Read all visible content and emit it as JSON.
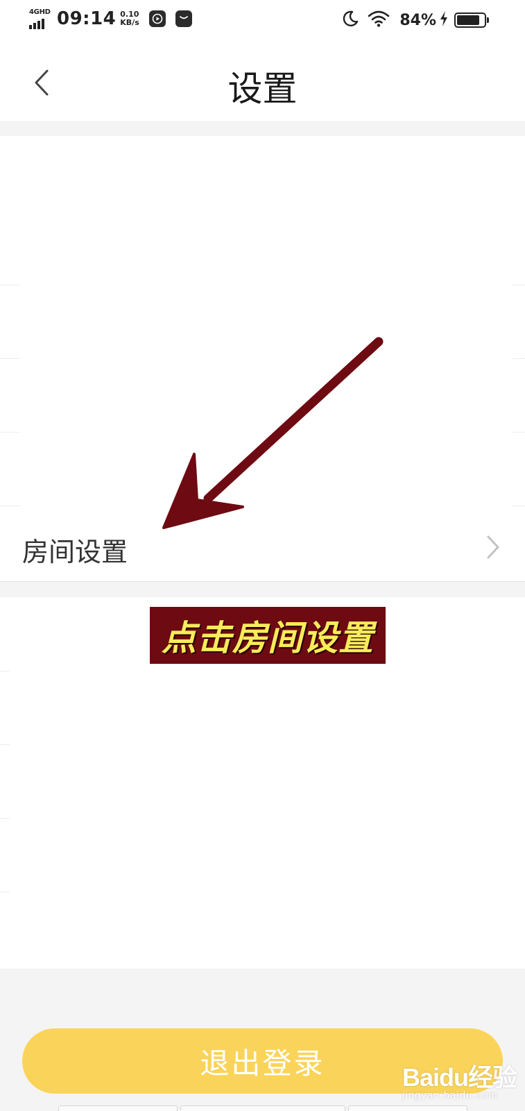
{
  "status_bar": {
    "network_label": "4GHD",
    "time": "09:14",
    "speed_value": "0.10",
    "speed_unit": "KB/s",
    "battery_percent": "84%",
    "battery_level": 0.84,
    "icons": [
      "signal-icon",
      "video-app-icon",
      "message-app-icon",
      "moon-icon",
      "wifi-icon",
      "charging-icon",
      "battery-icon"
    ]
  },
  "nav": {
    "title": "设置",
    "back_icon": "chevron-left-icon"
  },
  "settings": {
    "rows": [
      {
        "label": "房间设置",
        "icon": "chevron-right-icon"
      }
    ]
  },
  "annotation": {
    "callout_text": "点击房间设置",
    "arrow_color": "#6e0a12",
    "callout_bg": "#6e0a12",
    "callout_text_color": "#f7ec5a"
  },
  "footer": {
    "logout_label": "退出登录",
    "logout_color": "#fad45a"
  },
  "watermark": {
    "logo": "Baidu经验",
    "sub": "jingyan.baidu.com"
  }
}
